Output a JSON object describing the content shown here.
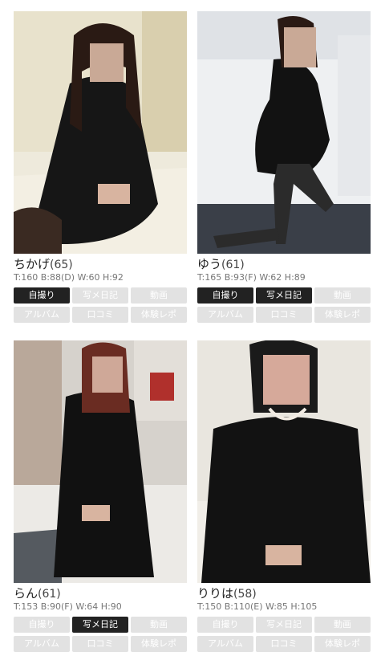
{
  "colors": {
    "button_inactive_bg": "#e2e2e2",
    "button_active_bg": "#222222",
    "button_text": "#ffffff",
    "specs_text": "#777777"
  },
  "profiles": [
    {
      "name": "ちかげ",
      "age": "(65)",
      "specs": "T:160 B:88(D) W:60 H:92",
      "buttons": {
        "selfie": {
          "label": "自撮り",
          "active": true
        },
        "photo_diary": {
          "label": "写メ日記",
          "active": false
        },
        "video": {
          "label": "動画",
          "active": false
        },
        "album": {
          "label": "アルバム",
          "active": false
        },
        "reviews": {
          "label": "口コミ",
          "active": false
        },
        "report": {
          "label": "体験レポ",
          "active": false
        }
      }
    },
    {
      "name": "ゆう",
      "age": "(61)",
      "specs": "T:165 B:93(F) W:62 H:89",
      "buttons": {
        "selfie": {
          "label": "自撮り",
          "active": true
        },
        "photo_diary": {
          "label": "写メ日記",
          "active": true
        },
        "video": {
          "label": "動画",
          "active": false
        },
        "album": {
          "label": "アルバム",
          "active": false
        },
        "reviews": {
          "label": "口コミ",
          "active": false
        },
        "report": {
          "label": "体験レポ",
          "active": false
        }
      }
    },
    {
      "name": "らん",
      "age": "(61)",
      "specs": "T:153 B:90(F) W:64 H:90",
      "buttons": {
        "selfie": {
          "label": "自撮り",
          "active": false
        },
        "photo_diary": {
          "label": "写メ日記",
          "active": true
        },
        "video": {
          "label": "動画",
          "active": false
        },
        "album": {
          "label": "アルバム",
          "active": false
        },
        "reviews": {
          "label": "口コミ",
          "active": false
        },
        "report": {
          "label": "体験レポ",
          "active": false
        }
      }
    },
    {
      "name": "りりは",
      "age": "(58)",
      "specs": "T:150 B:110(E) W:85 H:105",
      "buttons": {
        "selfie": {
          "label": "自撮り",
          "active": false
        },
        "photo_diary": {
          "label": "写メ日記",
          "active": false
        },
        "video": {
          "label": "動画",
          "active": false
        },
        "album": {
          "label": "アルバム",
          "active": false
        },
        "reviews": {
          "label": "口コミ",
          "active": false
        },
        "report": {
          "label": "体験レポ",
          "active": false
        }
      }
    }
  ]
}
